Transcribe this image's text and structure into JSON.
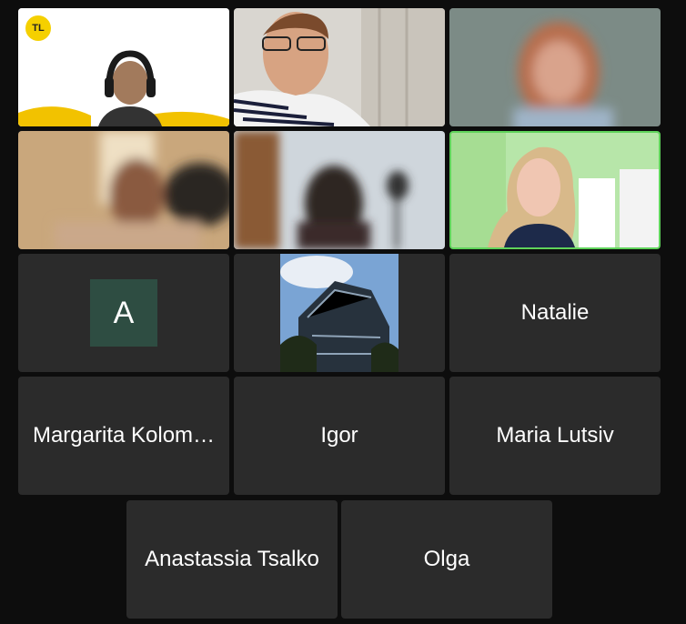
{
  "participants": [
    {
      "name": "Margarita Kolom…"
    },
    {
      "name": "Igor"
    },
    {
      "name": "Maria Lutsiv"
    },
    {
      "name": "Anastassia Tsalko"
    },
    {
      "name": "Olga"
    },
    {
      "name": "Natalie"
    }
  ],
  "avatar_tile": {
    "initial": "A",
    "color": "#2e4d42"
  },
  "logo_tile": {
    "logo_text": "TL"
  },
  "active_speaker_color": "#5fd35a"
}
